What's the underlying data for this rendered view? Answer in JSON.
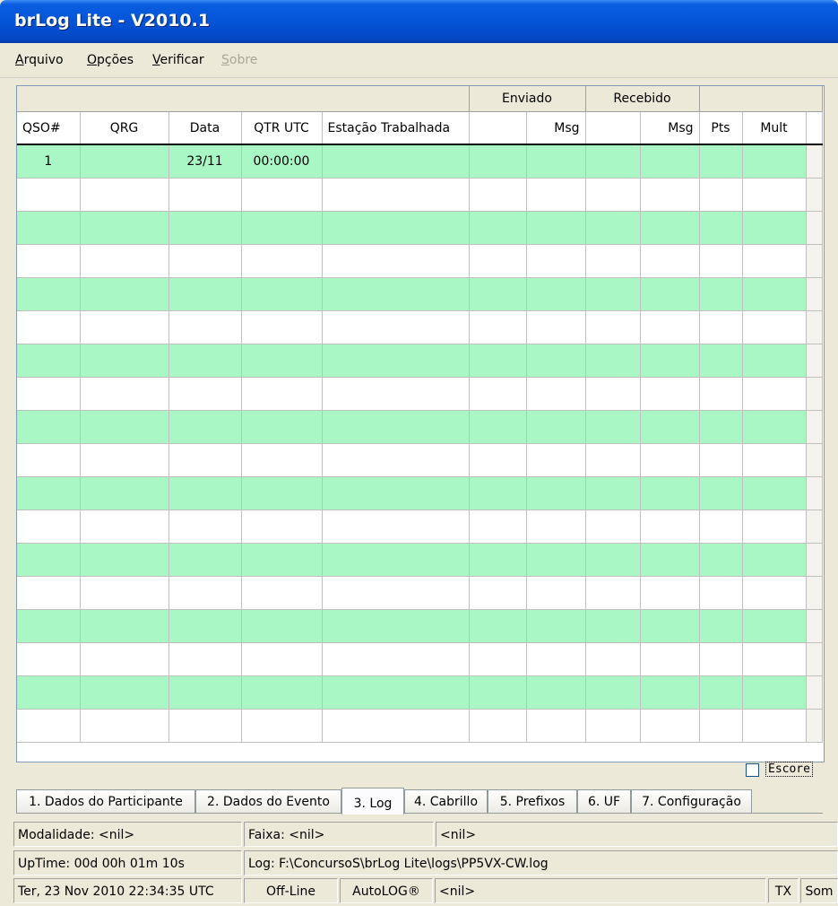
{
  "window": {
    "title": "brLog Lite - V2010.1"
  },
  "menu": [
    {
      "accel": "A",
      "rest": "rquivo",
      "enabled": true
    },
    {
      "accel": "O",
      "rest": "pções",
      "enabled": true
    },
    {
      "accel": "V",
      "rest": "erificar",
      "enabled": true
    },
    {
      "accel": "S",
      "rest": "obre",
      "enabled": false
    }
  ],
  "grid": {
    "groups": {
      "sent": "Enviado",
      "received": "Recebido"
    },
    "headers": [
      "QSO#",
      "QRG",
      "Data",
      "QTR UTC",
      "Estação Trabalhada",
      "",
      "Msg",
      "",
      "Msg",
      "Pts",
      "Mult"
    ],
    "rows": [
      [
        "1",
        "",
        "23/11",
        "00:00:00",
        "",
        "",
        "",
        "",
        "",
        "",
        ""
      ]
    ],
    "total_rows": 18
  },
  "escore": {
    "label": "Escore",
    "checked": false
  },
  "tabs": [
    {
      "label": "1. Dados do Participante",
      "active": false
    },
    {
      "label": "2. Dados do Evento",
      "active": false
    },
    {
      "label": "3. Log",
      "active": true
    },
    {
      "label": "4. Cabrillo",
      "active": false
    },
    {
      "label": "5. Prefixos",
      "active": false
    },
    {
      "label": "6. UF",
      "active": false
    },
    {
      "label": "7. Configuração",
      "active": false
    }
  ],
  "status": {
    "modalidade": "Modalidade: <nil>",
    "faixa": "Faixa: <nil>",
    "nil1": "<nil>",
    "uptime": "UpTime: 00d 00h 01m 10s",
    "log": "Log: F:\\ConcursoS\\brLog Lite\\logs\\PP5VX-CW.log",
    "datetime": "Ter, 23 Nov 2010 22:34:35 UTC",
    "offline": "Off-Line",
    "autolog": "AutoLOG®",
    "nil2": "<nil>",
    "tx": "TX",
    "som": "Som"
  },
  "colors": {
    "row_highlight": "#aaf7c6",
    "title_bar": "#0554d8"
  }
}
